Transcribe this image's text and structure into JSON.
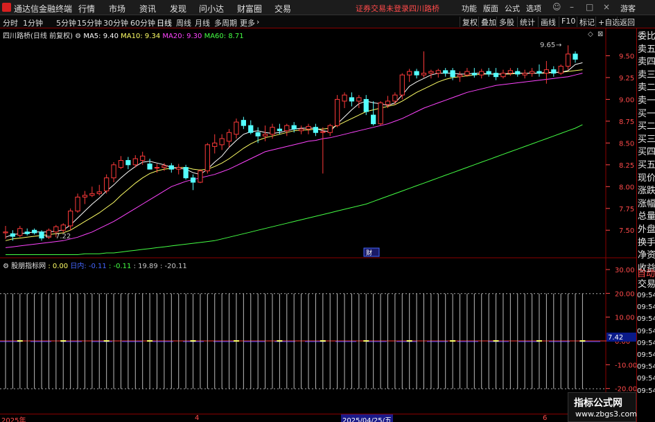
{
  "menubar": {
    "app_name": "通达信金融终端",
    "menus": [
      "行情",
      "市场",
      "资讯",
      "发现",
      "问小达",
      "财富圈",
      "交易"
    ],
    "warning": "证券交易未登录",
    "stock_name": "四川路桥",
    "right_buttons": [
      "功能",
      "版面",
      "公式",
      "选项"
    ],
    "guest": "游客"
  },
  "periodbar": {
    "periods": [
      "分时",
      "1分钟",
      "5分钟",
      "15分钟",
      "30分钟",
      "60分钟",
      "日线",
      "周线",
      "月线",
      "多周期",
      "更多"
    ],
    "active": "日线",
    "tools": [
      "复权",
      "叠加",
      "多股",
      "统计",
      "画线",
      "F10",
      "标记",
      "+自选",
      "返回"
    ]
  },
  "chart_title": {
    "name": "四川路桥(日线 前复权)",
    "ma5": "MA5: 9.40",
    "ma10": "MA10: 9.34",
    "ma20": "MA20: 9.30",
    "ma60": "MA60: 8.71"
  },
  "indicator_title": {
    "name": "股朋指标网",
    "v1": ": 0.00",
    "v2": "日内: -0.11",
    "v3": ": -0.11",
    "v4": ": 19.89",
    "v5": ": -20.11"
  },
  "annotations": {
    "high_label": "9.65",
    "low_label": "7.22",
    "finance_badge": "财",
    "cursor_value": "7.42"
  },
  "price_axis": [
    "9.50",
    "9.25",
    "9.00",
    "8.75",
    "8.50",
    "8.25",
    "8.00",
    "7.75",
    "7.50"
  ],
  "ind_axis": [
    "30.00",
    "20.00",
    "10.00",
    "0.00",
    "-10.00",
    "-20.00"
  ],
  "sidebar": {
    "items": [
      "委比",
      "卖五",
      "卖四",
      "卖三",
      "卖二",
      "卖一",
      "买一",
      "买二",
      "买三",
      "买四",
      "买五",
      "现价",
      "涨跌",
      "涨幅",
      "总量",
      "外盘",
      "换手",
      "净资",
      "收益"
    ],
    "auto": "自动",
    "trade": "交易",
    "times": [
      "09:54",
      "09:54",
      "09:54",
      "09:54",
      "09:54",
      "09:54",
      "09:54",
      "09:54",
      "09:54"
    ]
  },
  "date_axis": [
    "2025年",
    "4",
    "2025/04/25/五",
    "6"
  ],
  "watermark": {
    "title": "指标公式网",
    "url": "www.zbgs3.com"
  },
  "colors": {
    "up": "#ff3a3a",
    "down": "#54ffff",
    "ma5": "#ffffff",
    "ma10": "#ffff66",
    "ma20": "#ff44ff",
    "ma60": "#44ff44",
    "axis": "#ff4a4a"
  },
  "chart_data": {
    "type": "candlestick",
    "ylim": [
      7.2,
      9.75
    ],
    "candles": [
      {
        "o": 7.47,
        "h": 7.55,
        "l": 7.4,
        "c": 7.48
      },
      {
        "o": 7.46,
        "h": 7.5,
        "l": 7.38,
        "c": 7.43
      },
      {
        "o": 7.44,
        "h": 7.55,
        "l": 7.42,
        "c": 7.52
      },
      {
        "o": 7.48,
        "h": 7.52,
        "l": 7.44,
        "c": 7.46
      },
      {
        "o": 7.5,
        "h": 7.52,
        "l": 7.45,
        "c": 7.47
      },
      {
        "o": 7.48,
        "h": 7.5,
        "l": 7.38,
        "c": 7.41
      },
      {
        "o": 7.42,
        "h": 7.52,
        "l": 7.4,
        "c": 7.5
      },
      {
        "o": 7.48,
        "h": 7.56,
        "l": 7.42,
        "c": 7.54
      },
      {
        "o": 7.5,
        "h": 7.58,
        "l": 7.47,
        "c": 7.56
      },
      {
        "o": 7.55,
        "h": 7.75,
        "l": 7.5,
        "c": 7.72
      },
      {
        "o": 7.72,
        "h": 7.92,
        "l": 7.7,
        "c": 7.88
      },
      {
        "o": 7.88,
        "h": 7.95,
        "l": 7.8,
        "c": 7.9
      },
      {
        "o": 7.9,
        "h": 8.0,
        "l": 7.88,
        "c": 7.92
      },
      {
        "o": 7.92,
        "h": 8.02,
        "l": 7.9,
        "c": 7.94
      },
      {
        "o": 7.95,
        "h": 8.14,
        "l": 7.92,
        "c": 8.1
      },
      {
        "o": 8.1,
        "h": 8.28,
        "l": 8.05,
        "c": 8.25
      },
      {
        "o": 8.22,
        "h": 8.35,
        "l": 8.2,
        "c": 8.3
      },
      {
        "o": 8.3,
        "h": 8.34,
        "l": 8.2,
        "c": 8.25
      },
      {
        "o": 8.25,
        "h": 8.36,
        "l": 8.22,
        "c": 8.32
      },
      {
        "o": 8.3,
        "h": 8.4,
        "l": 8.25,
        "c": 8.35
      },
      {
        "o": 8.26,
        "h": 8.32,
        "l": 8.2,
        "c": 8.2
      },
      {
        "o": 8.22,
        "h": 8.26,
        "l": 8.16,
        "c": 8.22
      },
      {
        "o": 8.22,
        "h": 8.27,
        "l": 8.18,
        "c": 8.24
      },
      {
        "o": 8.24,
        "h": 8.27,
        "l": 8.16,
        "c": 8.2
      },
      {
        "o": 8.2,
        "h": 8.26,
        "l": 8.14,
        "c": 8.22
      },
      {
        "o": 8.22,
        "h": 8.25,
        "l": 8.08,
        "c": 8.1
      },
      {
        "o": 8.1,
        "h": 8.14,
        "l": 7.96,
        "c": 8.05
      },
      {
        "o": 8.05,
        "h": 8.2,
        "l": 8.04,
        "c": 8.18
      },
      {
        "o": 8.18,
        "h": 8.5,
        "l": 8.15,
        "c": 8.48
      },
      {
        "o": 8.46,
        "h": 8.6,
        "l": 8.38,
        "c": 8.5
      },
      {
        "o": 8.48,
        "h": 8.6,
        "l": 8.42,
        "c": 8.55
      },
      {
        "o": 8.52,
        "h": 8.66,
        "l": 8.45,
        "c": 8.62
      },
      {
        "o": 8.6,
        "h": 8.78,
        "l": 8.55,
        "c": 8.74
      },
      {
        "o": 8.76,
        "h": 8.8,
        "l": 8.66,
        "c": 8.7
      },
      {
        "o": 8.7,
        "h": 8.76,
        "l": 8.6,
        "c": 8.62
      },
      {
        "o": 8.62,
        "h": 8.68,
        "l": 8.5,
        "c": 8.58
      },
      {
        "o": 8.58,
        "h": 8.7,
        "l": 8.52,
        "c": 8.6
      },
      {
        "o": 8.6,
        "h": 8.72,
        "l": 8.55,
        "c": 8.68
      },
      {
        "o": 8.66,
        "h": 8.72,
        "l": 8.6,
        "c": 8.64
      },
      {
        "o": 8.64,
        "h": 8.72,
        "l": 8.58,
        "c": 8.7
      },
      {
        "o": 8.7,
        "h": 8.74,
        "l": 8.62,
        "c": 8.66
      },
      {
        "o": 8.64,
        "h": 8.7,
        "l": 8.6,
        "c": 8.66
      },
      {
        "o": 8.66,
        "h": 8.72,
        "l": 8.6,
        "c": 8.69
      },
      {
        "o": 8.68,
        "h": 8.72,
        "l": 8.58,
        "c": 8.62
      },
      {
        "o": 8.62,
        "h": 8.68,
        "l": 8.15,
        "c": 8.63
      },
      {
        "o": 8.62,
        "h": 8.72,
        "l": 8.58,
        "c": 8.7
      },
      {
        "o": 8.7,
        "h": 9.05,
        "l": 8.68,
        "c": 9.0
      },
      {
        "o": 8.98,
        "h": 9.08,
        "l": 8.9,
        "c": 9.05
      },
      {
        "o": 9.02,
        "h": 9.08,
        "l": 8.92,
        "c": 8.98
      },
      {
        "o": 8.98,
        "h": 9.05,
        "l": 8.9,
        "c": 9.02
      },
      {
        "o": 9.0,
        "h": 9.05,
        "l": 8.82,
        "c": 8.86
      },
      {
        "o": 8.82,
        "h": 8.98,
        "l": 8.7,
        "c": 8.72
      },
      {
        "o": 8.72,
        "h": 8.98,
        "l": 8.7,
        "c": 8.96
      },
      {
        "o": 8.94,
        "h": 9.04,
        "l": 8.9,
        "c": 8.98
      },
      {
        "o": 8.98,
        "h": 9.08,
        "l": 8.94,
        "c": 9.05
      },
      {
        "o": 9.05,
        "h": 9.3,
        "l": 9.0,
        "c": 9.28
      },
      {
        "o": 9.28,
        "h": 9.35,
        "l": 9.2,
        "c": 9.32
      },
      {
        "o": 9.32,
        "h": 9.35,
        "l": 9.24,
        "c": 9.28
      },
      {
        "o": 9.28,
        "h": 9.55,
        "l": 9.25,
        "c": 9.3
      },
      {
        "o": 9.3,
        "h": 9.34,
        "l": 9.24,
        "c": 9.32
      },
      {
        "o": 9.3,
        "h": 9.35,
        "l": 9.25,
        "c": 9.33
      },
      {
        "o": 9.33,
        "h": 9.36,
        "l": 9.26,
        "c": 9.3
      },
      {
        "o": 9.33,
        "h": 9.36,
        "l": 9.22,
        "c": 9.26
      },
      {
        "o": 9.26,
        "h": 9.32,
        "l": 9.2,
        "c": 9.28
      },
      {
        "o": 9.28,
        "h": 9.36,
        "l": 9.26,
        "c": 9.32
      },
      {
        "o": 9.3,
        "h": 9.36,
        "l": 9.25,
        "c": 9.28
      },
      {
        "o": 9.28,
        "h": 9.35,
        "l": 9.24,
        "c": 9.32
      },
      {
        "o": 9.32,
        "h": 9.36,
        "l": 9.26,
        "c": 9.29
      },
      {
        "o": 9.3,
        "h": 9.36,
        "l": 9.22,
        "c": 9.26
      },
      {
        "o": 9.26,
        "h": 9.34,
        "l": 9.24,
        "c": 9.3
      },
      {
        "o": 9.3,
        "h": 9.36,
        "l": 9.27,
        "c": 9.33
      },
      {
        "o": 9.32,
        "h": 9.36,
        "l": 9.26,
        "c": 9.29
      },
      {
        "o": 9.28,
        "h": 9.34,
        "l": 9.24,
        "c": 9.3
      },
      {
        "o": 9.3,
        "h": 9.36,
        "l": 9.26,
        "c": 9.32
      },
      {
        "o": 9.32,
        "h": 9.4,
        "l": 9.26,
        "c": 9.3
      },
      {
        "o": 9.3,
        "h": 9.44,
        "l": 9.18,
        "c": 9.34
      },
      {
        "o": 9.34,
        "h": 9.38,
        "l": 9.26,
        "c": 9.3
      },
      {
        "o": 9.3,
        "h": 9.4,
        "l": 9.28,
        "c": 9.38
      },
      {
        "o": 9.38,
        "h": 9.62,
        "l": 9.34,
        "c": 9.52
      },
      {
        "o": 9.52,
        "h": 9.55,
        "l": 9.42,
        "c": 9.46
      }
    ],
    "ma5": [
      7.42,
      7.45,
      7.46,
      7.47,
      7.48,
      7.48,
      7.48,
      7.49,
      7.5,
      7.56,
      7.64,
      7.72,
      7.8,
      7.87,
      7.95,
      8.02,
      8.1,
      8.17,
      8.23,
      8.28,
      8.29,
      8.27,
      8.25,
      8.22,
      8.21,
      8.2,
      8.16,
      8.14,
      8.2,
      8.28,
      8.35,
      8.45,
      8.53,
      8.6,
      8.63,
      8.64,
      8.62,
      8.61,
      8.62,
      8.64,
      8.66,
      8.67,
      8.67,
      8.67,
      8.64,
      8.63,
      8.72,
      8.8,
      8.88,
      8.95,
      8.98,
      8.96,
      8.95,
      8.93,
      8.96,
      9.05,
      9.15,
      9.2,
      9.24,
      9.28,
      9.3,
      9.3,
      9.3,
      9.29,
      9.29,
      9.3,
      9.3,
      9.29,
      9.29,
      9.29,
      9.3,
      9.3,
      9.3,
      9.3,
      9.3,
      9.31,
      9.31,
      9.31,
      9.33,
      9.4,
      9.42
    ],
    "ma10": [
      7.38,
      7.4,
      7.41,
      7.42,
      7.43,
      7.44,
      7.45,
      7.46,
      7.47,
      7.5,
      7.55,
      7.6,
      7.65,
      7.7,
      7.76,
      7.82,
      7.9,
      7.97,
      8.04,
      8.1,
      8.15,
      8.18,
      8.2,
      8.21,
      8.22,
      8.22,
      8.2,
      8.19,
      8.2,
      8.23,
      8.27,
      8.32,
      8.38,
      8.44,
      8.49,
      8.53,
      8.56,
      8.58,
      8.6,
      8.62,
      8.64,
      8.65,
      8.65,
      8.66,
      8.66,
      8.67,
      8.7,
      8.74,
      8.78,
      8.82,
      8.86,
      8.88,
      8.9,
      8.92,
      8.94,
      8.98,
      9.03,
      9.08,
      9.12,
      9.16,
      9.2,
      9.23,
      9.25,
      9.26,
      9.27,
      9.28,
      9.29,
      9.29,
      9.29,
      9.29,
      9.29,
      9.3,
      9.3,
      9.3,
      9.3,
      9.3,
      9.31,
      9.31,
      9.32,
      9.33,
      9.34
    ],
    "ma20": [
      7.3,
      7.31,
      7.32,
      7.33,
      7.34,
      7.35,
      7.36,
      7.37,
      7.38,
      7.4,
      7.42,
      7.45,
      7.48,
      7.52,
      7.56,
      7.6,
      7.65,
      7.7,
      7.75,
      7.8,
      7.85,
      7.9,
      7.95,
      8.0,
      8.03,
      8.06,
      8.08,
      8.1,
      8.12,
      8.14,
      8.17,
      8.2,
      8.24,
      8.28,
      8.32,
      8.36,
      8.4,
      8.42,
      8.44,
      8.46,
      8.48,
      8.5,
      8.52,
      8.53,
      8.55,
      8.56,
      8.58,
      8.6,
      8.62,
      8.64,
      8.66,
      8.68,
      8.7,
      8.72,
      8.75,
      8.78,
      8.82,
      8.86,
      8.9,
      8.93,
      8.96,
      8.99,
      9.02,
      9.05,
      9.08,
      9.1,
      9.12,
      9.14,
      9.16,
      9.17,
      9.18,
      9.19,
      9.2,
      9.21,
      9.22,
      9.23,
      9.24,
      9.25,
      9.26,
      9.28,
      9.3
    ],
    "ma60": [
      7.22,
      7.22,
      7.22,
      7.22,
      7.22,
      7.22,
      7.22,
      7.22,
      7.22,
      7.22,
      7.22,
      7.23,
      7.23,
      7.23,
      7.24,
      7.24,
      7.25,
      7.26,
      7.27,
      7.28,
      7.29,
      7.3,
      7.31,
      7.32,
      7.33,
      7.34,
      7.35,
      7.36,
      7.37,
      7.38,
      7.4,
      7.42,
      7.44,
      7.46,
      7.48,
      7.5,
      7.52,
      7.54,
      7.56,
      7.58,
      7.6,
      7.62,
      7.64,
      7.66,
      7.68,
      7.7,
      7.72,
      7.74,
      7.76,
      7.78,
      7.8,
      7.83,
      7.86,
      7.89,
      7.92,
      7.95,
      7.98,
      8.01,
      8.04,
      8.07,
      8.1,
      8.13,
      8.16,
      8.19,
      8.22,
      8.25,
      8.28,
      8.31,
      8.34,
      8.37,
      8.4,
      8.43,
      8.46,
      8.49,
      8.52,
      8.55,
      8.58,
      8.61,
      8.64,
      8.67,
      8.71
    ],
    "indicator": {
      "ylim": [
        -30,
        30
      ],
      "upper": 19.89,
      "lower": -20.11,
      "zero": 0.0,
      "bars": 81
    }
  }
}
